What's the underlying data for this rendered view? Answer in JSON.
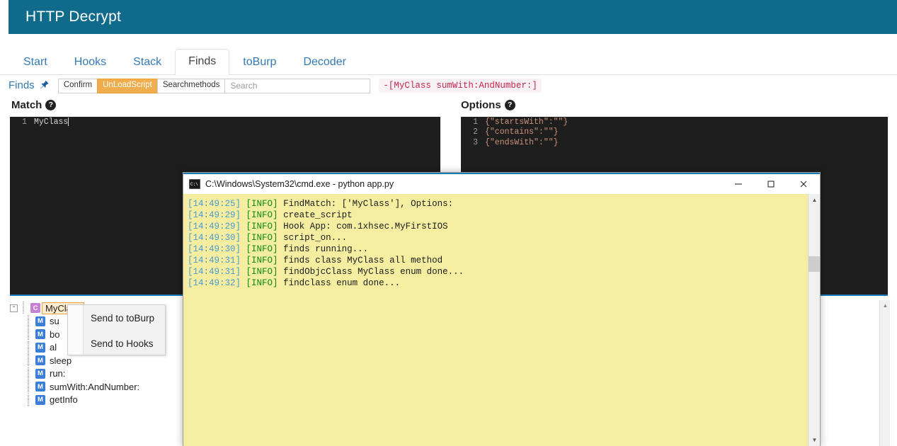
{
  "app": {
    "title": "HTTP Decrypt",
    "header_color": "#106a8c"
  },
  "tabs": [
    {
      "label": "Start",
      "active": false
    },
    {
      "label": "Hooks",
      "active": false
    },
    {
      "label": "Stack",
      "active": false
    },
    {
      "label": "Finds",
      "active": true
    },
    {
      "label": "toBurp",
      "active": false
    },
    {
      "label": "Decoder",
      "active": false
    }
  ],
  "toolbar": {
    "section_label": "Finds",
    "pin_icon": "thumbtack-icon",
    "confirm_label": "Confirm",
    "unload_label": "UnLoadScript",
    "searchmethods_label": "Searchmethods",
    "search_value": "",
    "search_placeholder": "Search",
    "selected_signature": "-[MyClass sumWith:AndNumber:]",
    "unload_color": "#f0ad4e",
    "signature_color": "#c7254e"
  },
  "panels": {
    "match": {
      "heading": "Match",
      "help_icon": "question-mark-icon",
      "lines": [
        {
          "no": "1",
          "text": "MyClass"
        }
      ]
    },
    "options": {
      "heading": "Options",
      "help_icon": "question-mark-icon",
      "lines": [
        {
          "no": "1",
          "text": "{\"startsWith\":\"\"}"
        },
        {
          "no": "2",
          "text": "{\"contains\":\"\"}"
        },
        {
          "no": "3",
          "text": "{\"endsWith\":\"\"}"
        }
      ]
    }
  },
  "tree": {
    "root": {
      "expander": "-",
      "badge": "C",
      "label": "MyClass",
      "selected": true
    },
    "children": [
      {
        "badge": "M",
        "label": "su"
      },
      {
        "badge": "M",
        "label": "bo"
      },
      {
        "badge": "M",
        "label": "al"
      },
      {
        "badge": "M",
        "label": "sleep"
      },
      {
        "badge": "M",
        "label": "run:"
      },
      {
        "badge": "M",
        "label": "sumWith:AndNumber:"
      },
      {
        "badge": "M",
        "label": "getInfo"
      }
    ]
  },
  "context_menu": {
    "items": [
      {
        "label": "Send to toBurp"
      },
      {
        "label": "Send to Hooks"
      }
    ]
  },
  "cmd_window": {
    "icon": "cmd-console-icon",
    "title": "C:\\Windows\\System32\\cmd.exe - python  app.py",
    "minimize_label": "—",
    "maximize_label": "□",
    "close_label": "✕",
    "background_color": "#f5eea0",
    "scroll_up_label": "▲",
    "scroll_down_label": "▼",
    "log": [
      {
        "time": "[14:49:25]",
        "level": "[INFO]",
        "message": "FindMatch: ['MyClass'], Options:"
      },
      {
        "time": "[14:49:29]",
        "level": "[INFO]",
        "message": "create_script"
      },
      {
        "time": "[14:49:29]",
        "level": "[INFO]",
        "message": "Hook App: com.1xhsec.MyFirstIOS"
      },
      {
        "time": "[14:49:30]",
        "level": "[INFO]",
        "message": "script_on..."
      },
      {
        "time": "[14:49:30]",
        "level": "[INFO]",
        "message": "finds running..."
      },
      {
        "time": "[14:49:31]",
        "level": "[INFO]",
        "message": "finds class MyClass all method"
      },
      {
        "time": "[14:49:31]",
        "level": "[INFO]",
        "message": "findObjcClass MyClass enum done..."
      },
      {
        "time": "[14:49:32]",
        "level": "[INFO]",
        "message": "findclass enum done..."
      }
    ]
  },
  "right_scrollbar": {
    "up_label": "▲"
  }
}
